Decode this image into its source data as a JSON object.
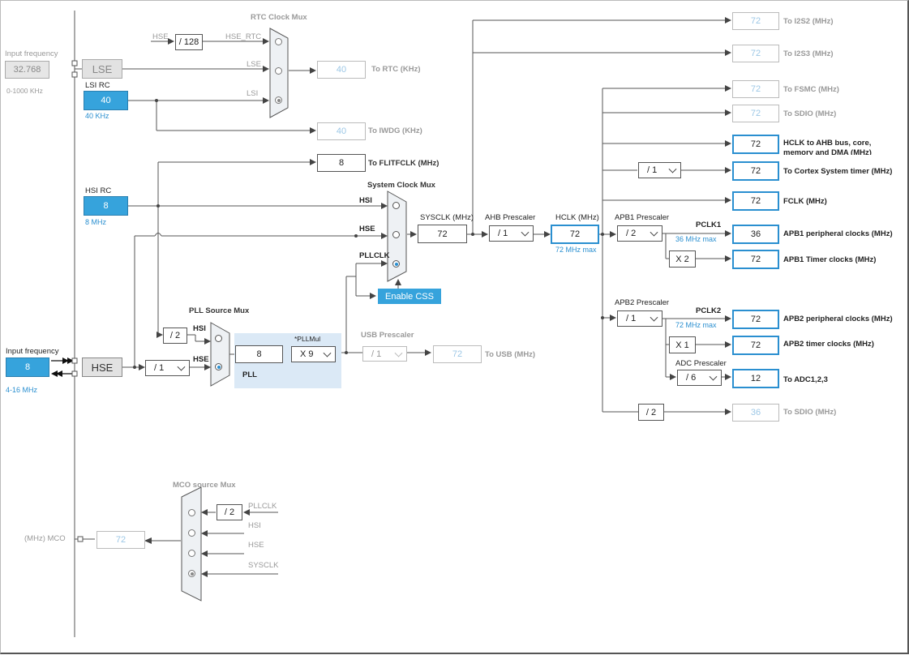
{
  "input_hse": {
    "label": "Input frequency",
    "value": "8",
    "range": "4-16 MHz",
    "osc": "HSE"
  },
  "input_lse": {
    "label": "Input frequency",
    "value": "32.768",
    "range": "0-1000 KHz",
    "osc": "LSE"
  },
  "lsi": {
    "label": "LSI RC",
    "value": "40",
    "freq": "40 KHz"
  },
  "hsi": {
    "label": "HSI RC",
    "value": "8",
    "freq": "8 MHz"
  },
  "rtc": {
    "title": "RTC Clock Mux",
    "hse": "HSE",
    "div": "/ 128",
    "hse_rtc": "HSE_RTC",
    "lse": "LSE",
    "lsi": "LSI",
    "out": "40",
    "out_label": "To RTC (KHz)"
  },
  "iwdg": {
    "out": "40",
    "label": "To IWDG (KHz)"
  },
  "flitf": {
    "out": "8",
    "label": "To FLITFCLK (MHz)"
  },
  "sysmux": {
    "title": "System Clock Mux",
    "hsi": "HSI",
    "hse": "HSE",
    "pllclk": "PLLCLK",
    "css": "Enable CSS"
  },
  "sysclk": {
    "label": "SYSCLK (MHz)",
    "value": "72"
  },
  "ahb": {
    "label": "AHB Prescaler",
    "value": "/ 1"
  },
  "hclk": {
    "label": "HCLK (MHz)",
    "value": "72",
    "max": "72 MHz max"
  },
  "apb1": {
    "label": "APB1 Prescaler",
    "value": "/ 2",
    "pclk": "PCLK1",
    "max": "36 MHz max",
    "mult": "X 2"
  },
  "apb2": {
    "label": "APB2 Prescaler",
    "value": "/ 1",
    "pclk": "PCLK2",
    "max": "72 MHz max",
    "mult": "X 1"
  },
  "adc": {
    "label": "ADC Prescaler",
    "value": "/ 6"
  },
  "cortex_div": "/ 1",
  "sdio_div": "/ 2",
  "pll": {
    "title": "PLL Source Mux",
    "hsi_div": "/ 2",
    "hsi": "HSI",
    "hse": "HSE",
    "hse_div": "/ 1",
    "value": "8",
    "mul_label": "*PLLMul",
    "mul": "X 9",
    "name": "PLL"
  },
  "usb": {
    "label": "USB Prescaler",
    "div": "/ 1",
    "out": "72",
    "out_label": "To USB (MHz)"
  },
  "outputs": {
    "i2s2": {
      "v": "72",
      "l": "To I2S2 (MHz)"
    },
    "i2s3": {
      "v": "72",
      "l": "To I2S3 (MHz)"
    },
    "fsmc": {
      "v": "72",
      "l": "To FSMC (MHz)"
    },
    "sdio1": {
      "v": "72",
      "l": "To SDIO (MHz)"
    },
    "hclk_bus": {
      "v": "72",
      "l1": "HCLK to AHB bus, core,",
      "l2": "memory and DMA (MHz)"
    },
    "cortex": {
      "v": "72",
      "l": "To Cortex System timer (MHz)"
    },
    "fclk": {
      "v": "72",
      "l": "FCLK (MHz)"
    },
    "apb1p": {
      "v": "36",
      "l": "APB1 peripheral clocks (MHz)"
    },
    "apb1t": {
      "v": "72",
      "l": "APB1 Timer clocks (MHz)"
    },
    "apb2p": {
      "v": "72",
      "l": "APB2 peripheral clocks (MHz)"
    },
    "apb2t": {
      "v": "72",
      "l": "APB2 timer clocks (MHz)"
    },
    "adc": {
      "v": "12",
      "l": "To ADC1,2,3"
    },
    "sdio2": {
      "v": "36",
      "l": "To SDIO (MHz)"
    }
  },
  "mco": {
    "title": "MCO source Mux",
    "div": "/ 2",
    "pllclk": "PLLCLK",
    "hsi": "HSI",
    "hse": "HSE",
    "sysclk": "SYSCLK",
    "out": "72",
    "label": "(MHz) MCO"
  }
}
